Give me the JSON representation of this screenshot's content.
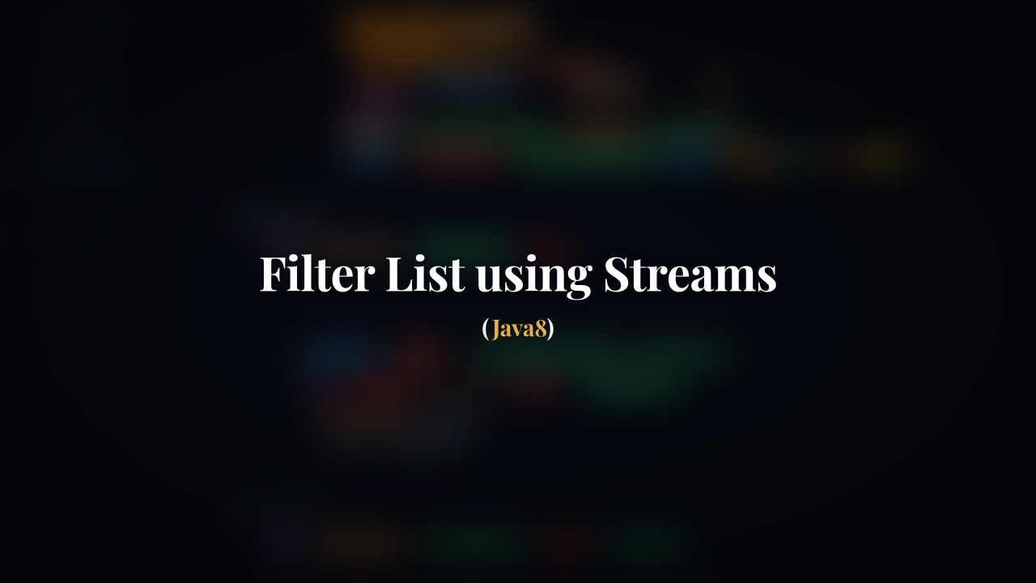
{
  "title": "Filter List using Streams",
  "subtitle": {
    "open_paren": "(",
    "inner": "Java8",
    "close_paren": ")"
  },
  "colors": {
    "title": "#ffffff",
    "subtitle_accent": "#e8b04b",
    "paren": "#f5f5f5",
    "background": "#060810"
  }
}
